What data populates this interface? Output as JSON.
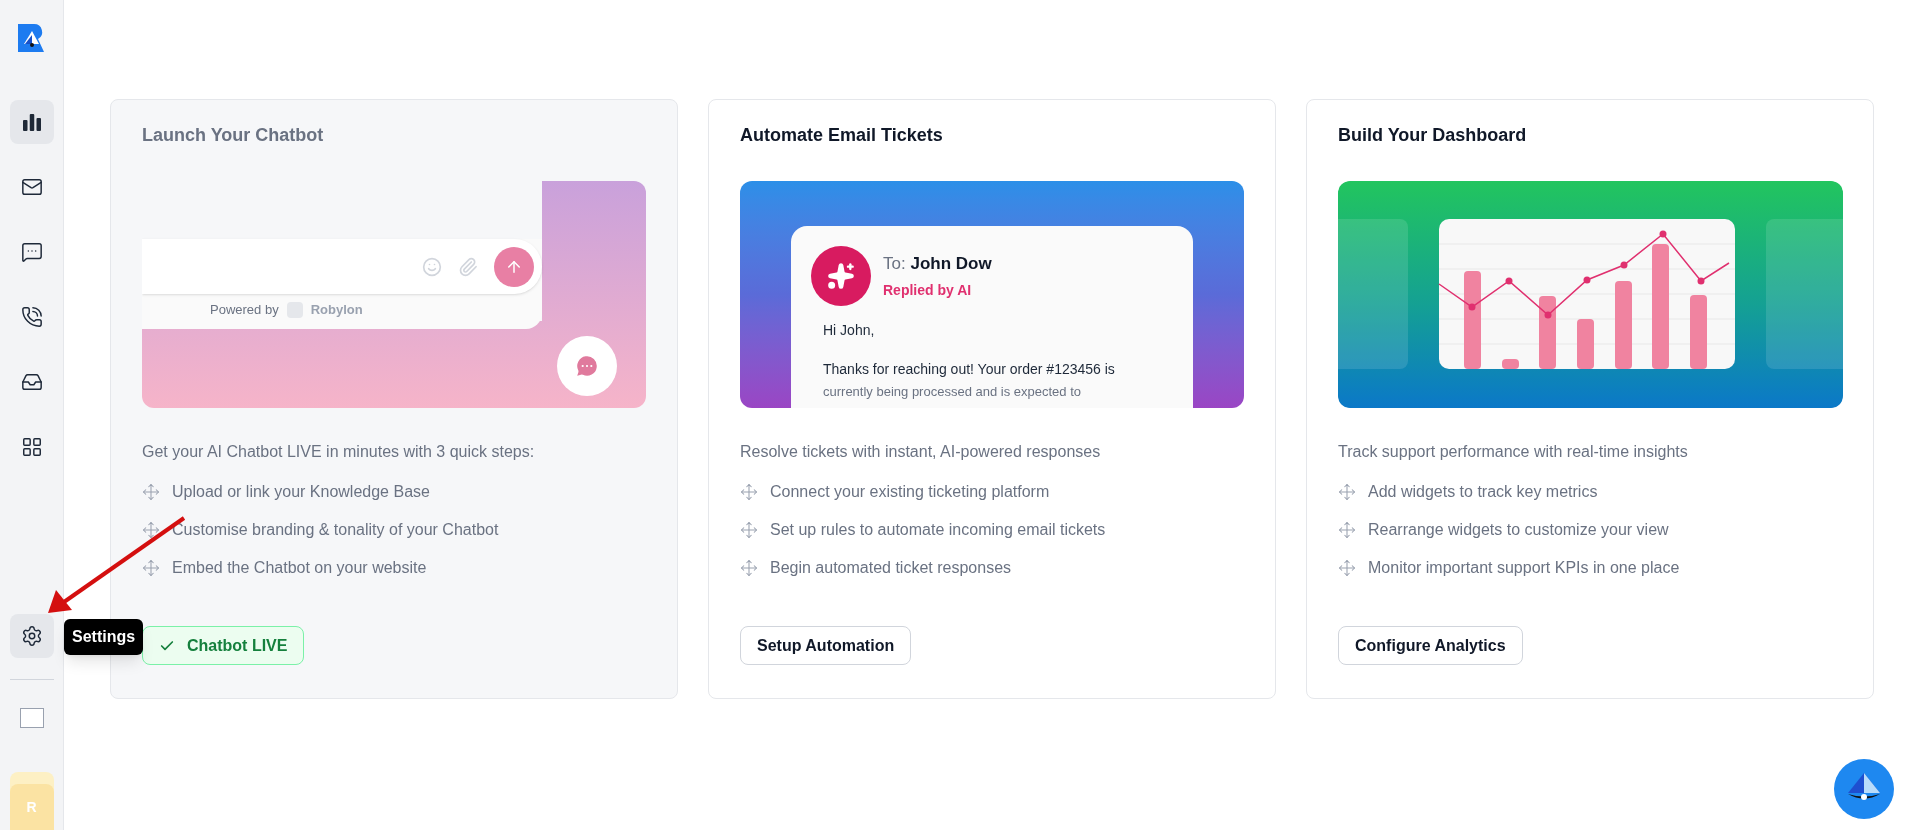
{
  "sidebar": {
    "items": [
      {
        "kind": "chart",
        "selected": true
      },
      {
        "kind": "mail",
        "selected": false
      },
      {
        "kind": "chat",
        "selected": false
      },
      {
        "kind": "phone",
        "selected": false
      },
      {
        "kind": "inbox",
        "selected": false
      },
      {
        "kind": "apps",
        "selected": false
      }
    ],
    "settings": {
      "tooltip": "Settings"
    },
    "avatar": {
      "initial": "R"
    }
  },
  "cards": [
    {
      "title": "Launch Your Chatbot",
      "completed": true,
      "illustration": {
        "kind": "chatbot",
        "powered_by": "Powered by",
        "brand": "Robylon"
      },
      "description": "Get your AI Chatbot LIVE in minutes with 3 quick steps:",
      "steps": [
        "Upload or link your Knowledge Base",
        "Customise branding & tonality of your Chatbot",
        "Embed the Chatbot on your website"
      ],
      "action": {
        "kind": "status",
        "label": "Chatbot LIVE"
      }
    },
    {
      "title": "Automate Email Tickets",
      "completed": false,
      "illustration": {
        "kind": "email",
        "to_label": "To:",
        "recipient": "John Dow",
        "status": "Replied by AI",
        "greeting": "Hi John,",
        "body": "Thanks for reaching out! Your order #123456 is",
        "body_more": "currently being processed and is expected to"
      },
      "description": "Resolve tickets with instant, AI-powered responses",
      "steps": [
        "Connect your existing ticketing platform",
        "Set up rules to automate incoming email tickets",
        "Begin automated ticket responses"
      ],
      "action": {
        "kind": "button",
        "label": "Setup Automation"
      }
    },
    {
      "title": "Build Your Dashboard",
      "completed": false,
      "illustration": {
        "kind": "dashboard"
      },
      "description": "Track support performance with real-time insights",
      "steps": [
        "Add widgets to track key metrics",
        "Rearrange widgets to customize your view",
        "Monitor important support KPIs in one place"
      ],
      "action": {
        "kind": "button",
        "label": "Configure Analytics"
      }
    }
  ]
}
